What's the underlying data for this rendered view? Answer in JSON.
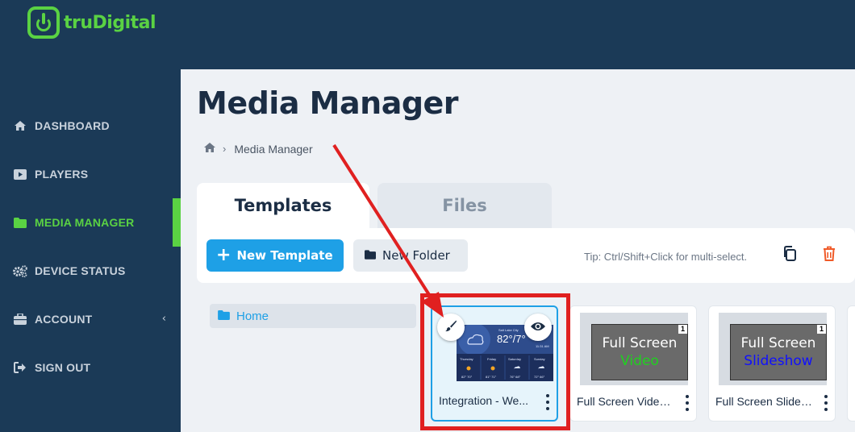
{
  "brand": {
    "name": "truDigital",
    "accent": "#5ad243",
    "navy": "#1b3a57"
  },
  "sidebar": {
    "items": [
      {
        "label": "DASHBOARD",
        "icon": "home-icon"
      },
      {
        "label": "PLAYERS",
        "icon": "play-icon"
      },
      {
        "label": "MEDIA MANAGER",
        "icon": "folder-icon",
        "active": true
      },
      {
        "label": "DEVICE STATUS",
        "icon": "cogs-icon"
      },
      {
        "label": "ACCOUNT",
        "icon": "briefcase-icon",
        "chevron": "‹"
      },
      {
        "label": "SIGN OUT",
        "icon": "sign-out-icon"
      }
    ]
  },
  "main": {
    "title": "Media Manager",
    "breadcrumb": {
      "current": "Media Manager",
      "separator": "›"
    },
    "tabs": [
      {
        "label": "Templates",
        "active": true
      },
      {
        "label": "Files",
        "active": false
      }
    ],
    "toolbar": {
      "new_template_label": "New Template",
      "new_template_plus": "+",
      "new_folder_label": "New Folder",
      "tip": "Tip: Ctrl/Shift+Click for multi-select."
    },
    "folder_tree": {
      "home_label": "Home"
    },
    "cards": [
      {
        "name": "Integration - We...",
        "selected": true,
        "thumb": {
          "city": "Salt Lake City",
          "temp": "82°/7°",
          "time": "11:31 AM",
          "days": [
            "Thursday",
            "Friday",
            "Saturday",
            "Sunday"
          ],
          "temps": [
            "82° 70°",
            "81° 71°",
            "76° 68°",
            "72° 66°"
          ]
        }
      },
      {
        "name": "Full Screen Video ...",
        "line1": "Full Screen",
        "line2": "Video",
        "line2_color": "#1fd11f",
        "badge": "1"
      },
      {
        "name": "Full Screen Slides...",
        "line1": "Full Screen",
        "line2": "Slideshow",
        "line2_color": "#1010ff",
        "badge": "1"
      }
    ]
  },
  "annotation": {
    "color": "#e02020"
  }
}
